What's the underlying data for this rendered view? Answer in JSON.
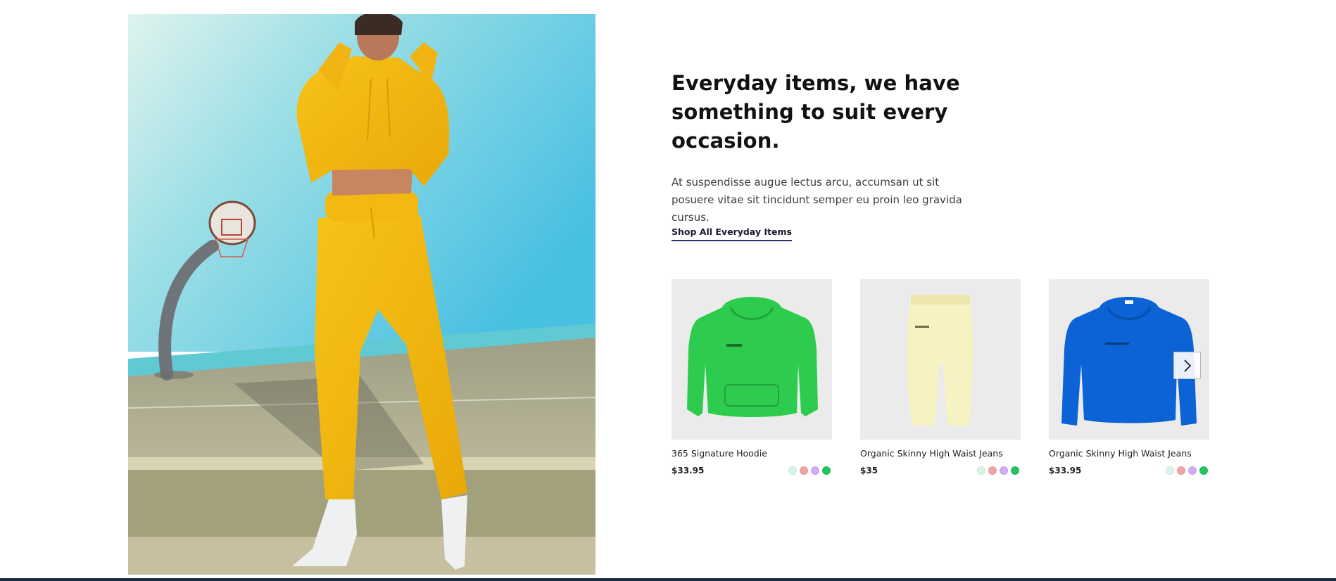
{
  "section": {
    "heading": "Everyday items, we have something to suit every occasion.",
    "description": "At suspendisse augue lectus arcu, accumsan ut sit posuere vitae sit tincidunt semper eu proin leo gravida cursus.",
    "cta_label": "Shop All Everyday Items"
  },
  "products": [
    {
      "name": "365 Signature Hoodie",
      "price": "$33.95",
      "item_color": "#2ecc4e",
      "swatches": [
        "#d9f5e5",
        "#f2a3a3",
        "#d2aaf5",
        "#22c55e"
      ]
    },
    {
      "name": "Organic Skinny High Waist Jeans",
      "price": "$35",
      "item_color": "#f6f2c2",
      "swatches": [
        "#d9f5e5",
        "#f2a3a3",
        "#d2aaf5",
        "#22c55e"
      ]
    },
    {
      "name": "Organic Skinny High Waist Jeans",
      "price": "$33.95",
      "item_color": "#0b63d6",
      "swatches": [
        "#d9f5e5",
        "#f2a3a3",
        "#d2aaf5",
        "#22c55e"
      ]
    }
  ],
  "icons": {
    "carousel_next": "chevron-right-icon"
  }
}
